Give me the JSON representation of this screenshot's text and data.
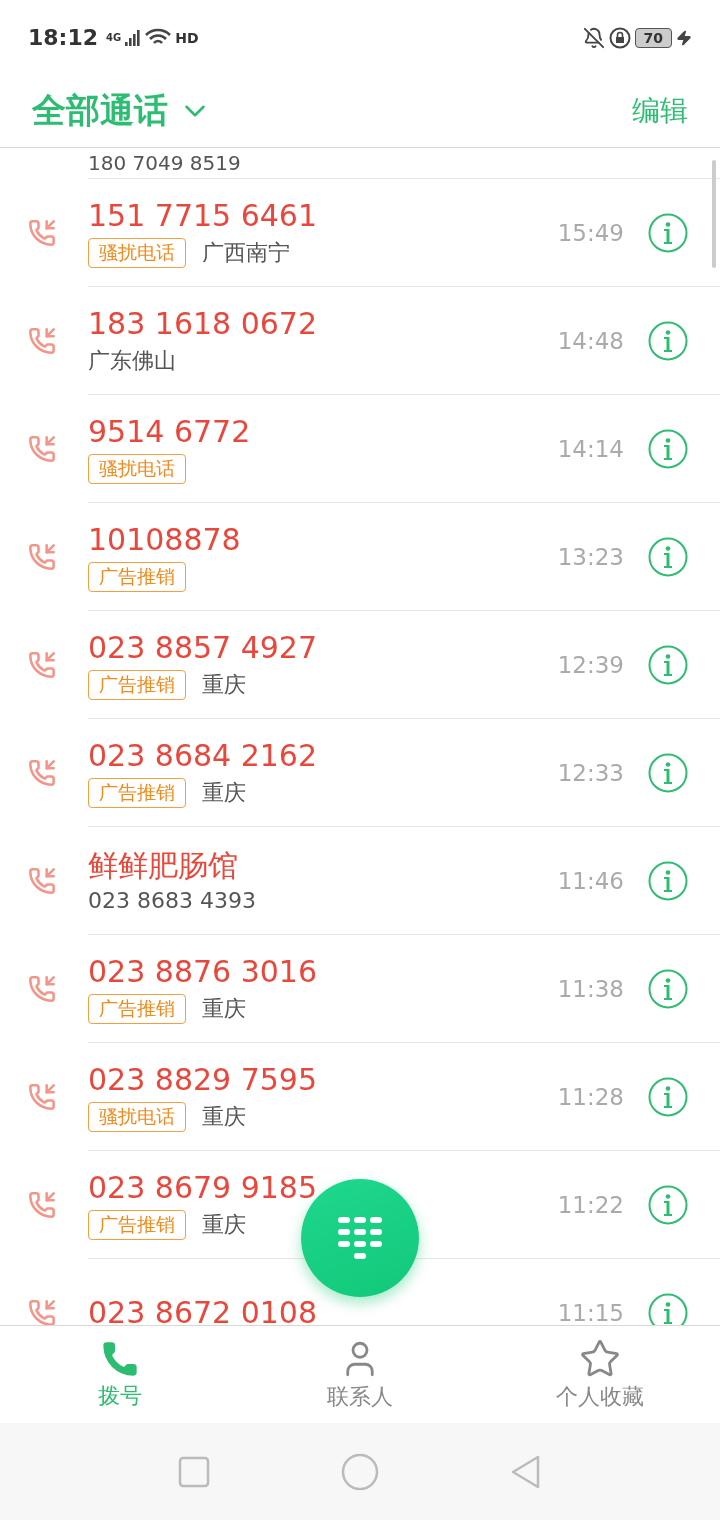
{
  "status_bar": {
    "time": "18:12",
    "network": "4G",
    "hd": "HD",
    "battery": "70"
  },
  "header": {
    "title": "全部通话",
    "edit": "编辑"
  },
  "partial_top_row": {
    "number": "180 7049 8519"
  },
  "calls": [
    {
      "number": "151 7715 6461",
      "tag": "骚扰电话",
      "location": "广西南宁",
      "time": "15:49"
    },
    {
      "number": "183 1618 0672",
      "location": "广东佛山",
      "time": "14:48"
    },
    {
      "number": "9514 6772",
      "tag": "骚扰电话",
      "time": "14:14"
    },
    {
      "number": "10108878",
      "tag": "广告推销",
      "time": "13:23"
    },
    {
      "number": "023 8857 4927",
      "tag": "广告推销",
      "location": "重庆",
      "time": "12:39"
    },
    {
      "number": "023 8684 2162",
      "tag": "广告推销",
      "location": "重庆",
      "time": "12:33"
    },
    {
      "number": "鲜鲜肥肠馆",
      "location": "023 8683 4393",
      "time": "11:46"
    },
    {
      "number": "023 8876 3016",
      "tag": "广告推销",
      "location": "重庆",
      "time": "11:38"
    },
    {
      "number": "023 8829 7595",
      "tag": "骚扰电话",
      "location": "重庆",
      "time": "11:28"
    },
    {
      "number": "023 8679 9185",
      "tag": "广告推销",
      "location": "重庆",
      "time": "11:22"
    },
    {
      "number": "023 8672 0108",
      "time": "11:15"
    }
  ],
  "tabs": [
    {
      "label": "拨号",
      "selected": true,
      "kind": "dial"
    },
    {
      "label": "联系人",
      "selected": false,
      "kind": "contacts"
    },
    {
      "label": "个人收藏",
      "selected": false,
      "kind": "favorites"
    }
  ]
}
